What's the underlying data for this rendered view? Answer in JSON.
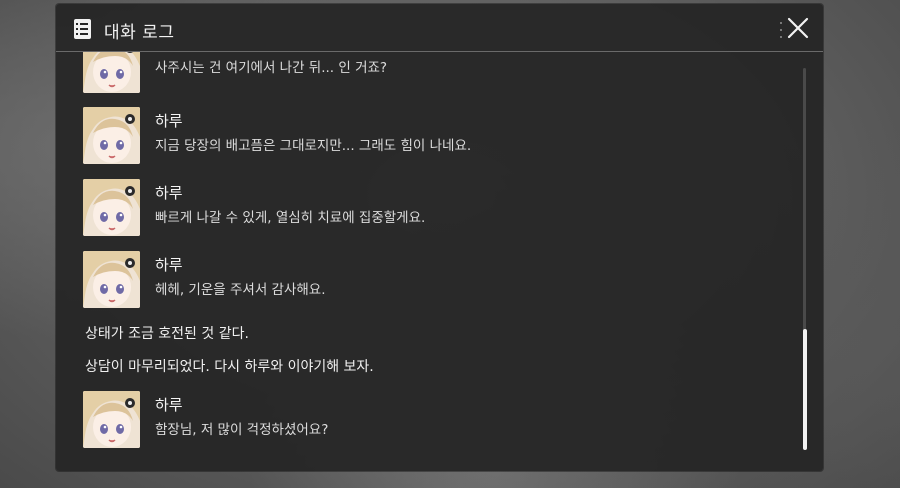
{
  "window": {
    "title": "대화 로그",
    "icons": {
      "log": "log-list-icon",
      "close": "close-icon",
      "more": "vertical-dots-icon"
    }
  },
  "colors": {
    "panel": "#262626",
    "text": "#f2f2f2",
    "subtext": "#dcdcdc",
    "scroll_thumb": "#f2f2f2"
  },
  "log": {
    "entries": [
      {
        "type": "dialogue",
        "speaker": "",
        "text": "사주시는 건 여기에서 나간 뒤... 인 거죠?"
      },
      {
        "type": "dialogue",
        "speaker": "하루",
        "text": "지금 당장의 배고픔은 그대로지만... 그래도 힘이 나네요."
      },
      {
        "type": "dialogue",
        "speaker": "하루",
        "text": "빠르게 나갈 수 있게, 열심히 치료에 집중할게요."
      },
      {
        "type": "dialogue",
        "speaker": "하루",
        "text": "헤헤, 기운을 주셔서 감사해요."
      },
      {
        "type": "narration",
        "text": "상태가 조금 호전된 것 같다."
      },
      {
        "type": "narration",
        "text": "상담이 마무리되었다. 다시 하루와 이야기해 보자."
      },
      {
        "type": "dialogue",
        "speaker": "하루",
        "text": "함장님, 저 많이 걱정하셨어요?"
      }
    ]
  },
  "scrollbar": {
    "position": 0.92
  }
}
